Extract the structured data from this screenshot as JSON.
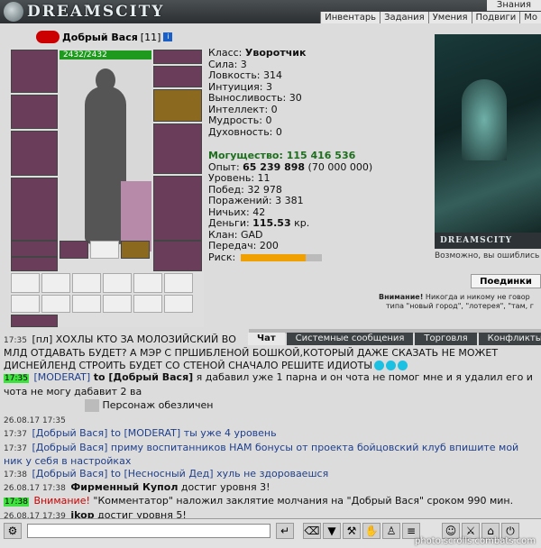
{
  "logo": "DREAMSCITY",
  "menu_top": "Знания",
  "menu": [
    "Инвентарь",
    "Задания",
    "Умения",
    "Подвиги",
    "Мо"
  ],
  "character": {
    "name": "Добрый Вася",
    "level": "[11]",
    "hp": "2432/2432"
  },
  "stats": {
    "class_label": "Класс:",
    "class_value": "Уворотчик",
    "strength": "Сила: 3",
    "agility": "Ловкость: 314",
    "intuition": "Интуиция: 3",
    "endurance": "Выносливость: 30",
    "intellect": "Интеллект: 0",
    "wisdom": "Мудрость: 0",
    "spirit": "Духовность: 0",
    "power_label": "Могущество:",
    "power_value": "115 416 536",
    "exp_label": "Опыт:",
    "exp_value": "65 239 898",
    "exp_next": "(70 000 000)",
    "level": "Уровень: 11",
    "wins": "Побед: 32 978",
    "losses": "Поражений: 3 381",
    "draws": "Ничьих: 42",
    "money_label": "Деньги:",
    "money_value": "115.53",
    "money_unit": "кр.",
    "clan": "Клан: GAD",
    "transfers": "Передач: 200",
    "risk_label": "Риск:",
    "risk_fraction": 0.8
  },
  "scene": {
    "ribbon": "DREAMSCITY",
    "note": "Возможно, вы ошиблись :",
    "duel_button": "Поединки",
    "warning_bold": "Внимание!",
    "warning_1": "Никогда и никому не говор",
    "warning_2": "типа \"новый город\", \"лотерея\", \"там, г"
  },
  "tabs": [
    "Чат",
    "Системные сообщения",
    "Торговля",
    "Конфликты"
  ],
  "chat": [
    {
      "time": "17:35",
      "hl": false,
      "text": "[пл] ХОХЛЫ КТО ЗА МОЛОЗИЙСКИЙ ВО"
    },
    {
      "time": "",
      "hl": false,
      "text": "МЛД ОТДАВАТЬ БУДЕТ? А МЭР С ПРШИБЛЕНОЙ БОШКОЙ,КОТОРЫЙ ДАЖЕ СКАЗАТЬ НЕ МОЖЕТ ДИСНЕЙЛЕНД СТРОИТЬ БУДЕТ СО СТЕНОЙ СНАЧАЛО РЕШИТЕ ИДИОТЫ"
    },
    {
      "time": "17:35",
      "hl": true,
      "nick": "[MODERAT]",
      "to": "to [Добрый Вася]",
      "text": "я дабавил уже 1 парна и он чота не помог мне и я удалил его и чота не могу дабавит 2 ва"
    },
    {
      "time": "",
      "hl": false,
      "text": "Персонаж обезличен"
    },
    {
      "time": "26.08.17 17:35",
      "hl": false,
      "text": ""
    },
    {
      "time": "17:37",
      "hl": false,
      "nick": "[Добрый Вася]",
      "to": "to [MODERAT]",
      "text": "ты уже 4 уровень"
    },
    {
      "time": "17:37",
      "hl": false,
      "nick": "[Добрый Вася]",
      "text": "приму воспитанников НАМ бонусы от проекта бойцовский клуб впишите мой ник у себя в настройках"
    },
    {
      "time": "17:38",
      "hl": false,
      "nick": "[Добрый Вася]",
      "to": "to [Несносный Дед]",
      "text": "хуль не здороваешся"
    },
    {
      "time": "26.08.17 17:38",
      "hl": false,
      "bold": "Фирменный Купол",
      "text": "достиг уровня 3!"
    },
    {
      "time": "17:38",
      "hl": true,
      "warn": "Внимание!",
      "text": "\"Комментатор\" наложил заклятие молчания на \"Добрый Вася\" сроком 990 мин."
    },
    {
      "time": "26.08.17 17:39",
      "hl": false,
      "bold": "jkop",
      "text": "достиг уровня 5!"
    }
  ],
  "watermark": "photo.scrolls.combats.com"
}
